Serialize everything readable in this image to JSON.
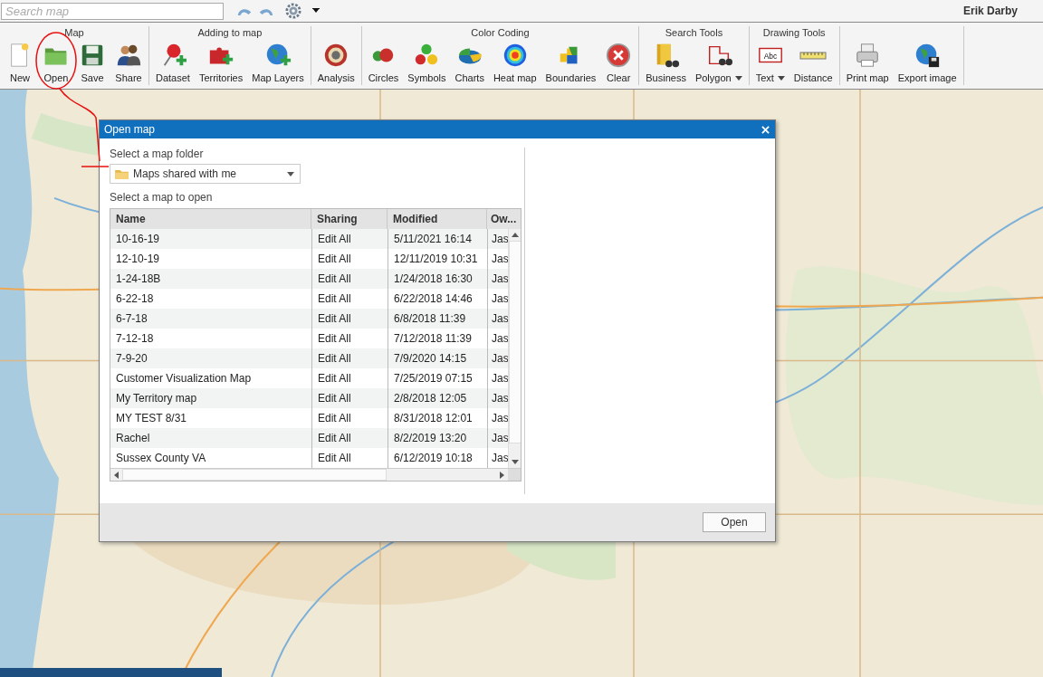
{
  "topbar": {
    "search": {
      "placeholder": "Search map"
    },
    "user": "Erik Darby"
  },
  "ribbon": [
    {
      "title": "Map",
      "tools": [
        {
          "label": "New",
          "has_menu": false
        },
        {
          "label": "Open",
          "has_menu": false
        },
        {
          "label": "Save",
          "has_menu": false
        },
        {
          "label": "Share",
          "has_menu": false
        }
      ]
    },
    {
      "title": "Adding to map",
      "tools": [
        {
          "label": "Dataset",
          "has_menu": false
        },
        {
          "label": "Territories",
          "has_menu": false
        },
        {
          "label": "Map Layers",
          "has_menu": false
        }
      ]
    },
    {
      "tools": [
        {
          "label": "Analysis",
          "has_menu": false
        }
      ]
    },
    {
      "title": "Color Coding",
      "tools": [
        {
          "label": "Circles",
          "has_menu": false
        },
        {
          "label": "Symbols",
          "has_menu": false
        },
        {
          "label": "Charts",
          "has_menu": false
        },
        {
          "label": "Heat map",
          "has_menu": false
        },
        {
          "label": "Boundaries",
          "has_menu": false
        },
        {
          "label": "Clear",
          "has_menu": false
        }
      ]
    },
    {
      "title": "Search Tools",
      "tools": [
        {
          "label": "Business",
          "has_menu": false
        },
        {
          "label": "Polygon",
          "has_menu": true
        }
      ]
    },
    {
      "title": "Drawing Tools",
      "tools": [
        {
          "label": "Text",
          "has_menu": true,
          "icon_text": "Abc"
        },
        {
          "label": "Distance",
          "has_menu": false
        }
      ]
    },
    {
      "tools": [
        {
          "label": "Print map",
          "has_menu": false
        },
        {
          "label": "Export image",
          "has_menu": false
        }
      ]
    }
  ],
  "dialog": {
    "title": "Open map",
    "folder_label": "Select a map folder",
    "folder": "Maps shared with me",
    "list_label": "Select a map to open",
    "columns": [
      "Name",
      "Sharing",
      "Modified",
      "Ow..."
    ],
    "rows": [
      [
        "10-16-19",
        "Edit All",
        "5/11/2021 16:14",
        "Jas"
      ],
      [
        "12-10-19",
        "Edit All",
        "12/11/2019 10:31",
        "Jas"
      ],
      [
        "1-24-18B",
        "Edit All",
        "1/24/2018 16:30",
        "Jas"
      ],
      [
        "6-22-18",
        "Edit All",
        "6/22/2018 14:46",
        "Jas"
      ],
      [
        "6-7-18",
        "Edit All",
        "6/8/2018 11:39",
        "Jas"
      ],
      [
        "7-12-18",
        "Edit All",
        "7/12/2018 11:39",
        "Jas"
      ],
      [
        "7-9-20",
        "Edit All",
        "7/9/2020 14:15",
        "Jas"
      ],
      [
        "Customer Visualization Map",
        "Edit All",
        "7/25/2019 07:15",
        "Jas"
      ],
      [
        "My Territory map",
        "Edit All",
        "2/8/2018 12:05",
        "Jas"
      ],
      [
        "MY TEST 8/31",
        "Edit All",
        "8/31/2018 12:01",
        "Jas"
      ],
      [
        "Rachel",
        "Edit All",
        "8/2/2019 13:20",
        "Jas"
      ],
      [
        "Sussex County VA",
        "Edit All",
        "6/12/2019 10:18",
        "Jas"
      ]
    ],
    "open_button": "Open"
  }
}
